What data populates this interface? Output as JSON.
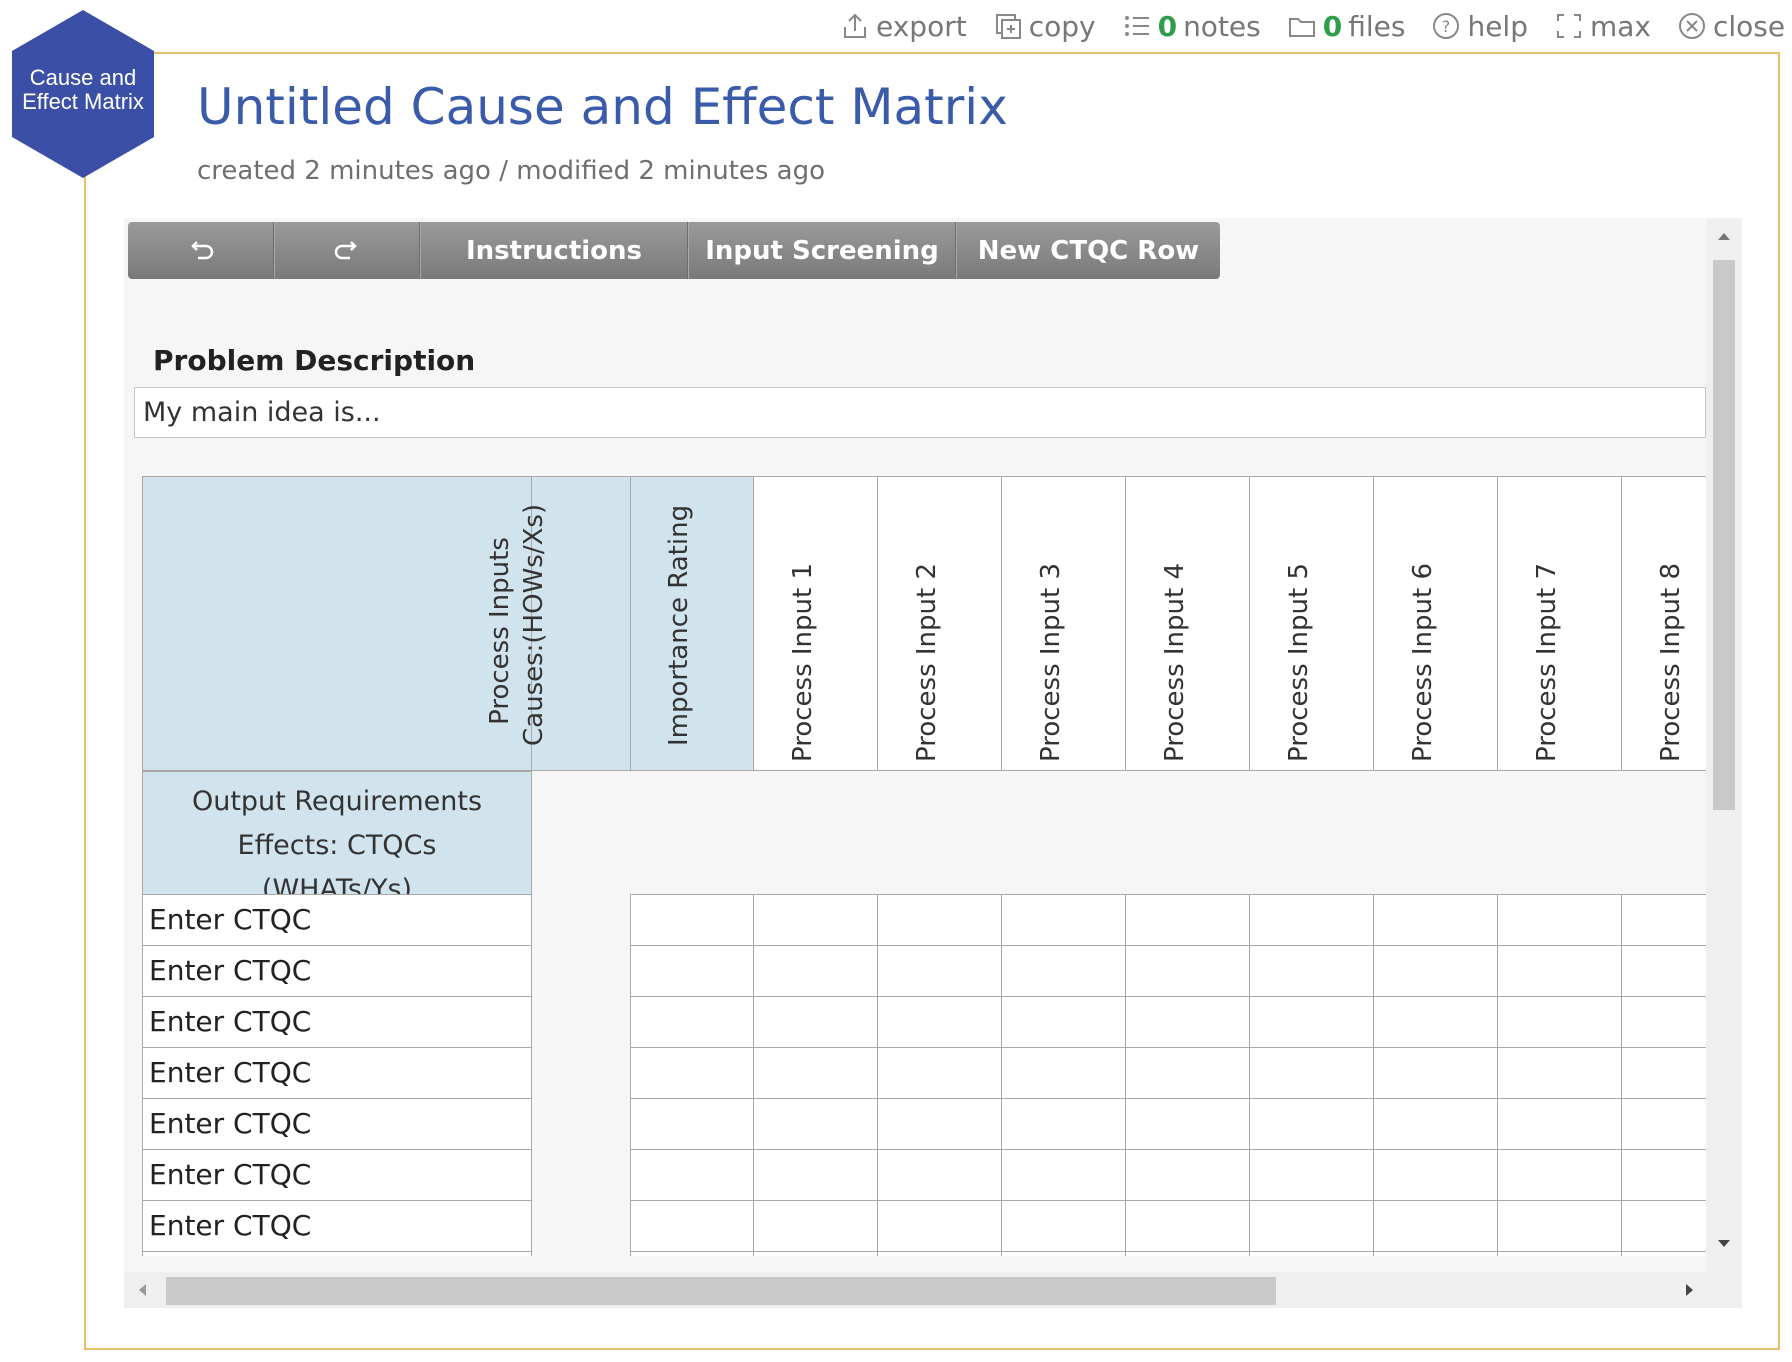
{
  "topbar": {
    "export": "export",
    "copy": "copy",
    "notes_count": "0",
    "notes": "notes",
    "files_count": "0",
    "files": "files",
    "help": "help",
    "max": "max",
    "close": "close"
  },
  "badge": {
    "line1": "Cause and",
    "line2": "Effect Matrix",
    "color": "#3b4fa6"
  },
  "document": {
    "title": "Untitled Cause and Effect Matrix",
    "meta": "created 2 minutes ago / modified 2 minutes ago"
  },
  "toolbar": {
    "undo_icon": "undo-icon",
    "redo_icon": "redo-icon",
    "instructions": "Instructions",
    "input_screening": "Input Screening",
    "new_ctqc_row": "New CTQC Row"
  },
  "problem": {
    "label": "Problem Description",
    "value": "My main idea is..."
  },
  "matrix": {
    "causes_header_line1": "Process Inputs",
    "causes_header_line2": "Causes:(HOWs/Xs)",
    "importance_header": "Importance Rating",
    "process_inputs": [
      "Process Input 1",
      "Process Input 2",
      "Process Input 3",
      "Process Input 4",
      "Process Input 5",
      "Process Input 6",
      "Process Input 7",
      "Process Input 8"
    ],
    "effects_header_line1": "Output Requirements",
    "effects_header_line2": "Effects: CTQCs",
    "effects_header_line3": "(WHATs/Ys)",
    "rows": [
      "Enter CTQC",
      "Enter CTQC",
      "Enter CTQC",
      "Enter CTQC",
      "Enter CTQC",
      "Enter CTQC",
      "Enter CTQC"
    ]
  },
  "colors": {
    "accent": "#3a5ba9",
    "header_blue": "#d1e3ec",
    "frame": "#e7c067",
    "count_green": "#2e9e4a"
  }
}
